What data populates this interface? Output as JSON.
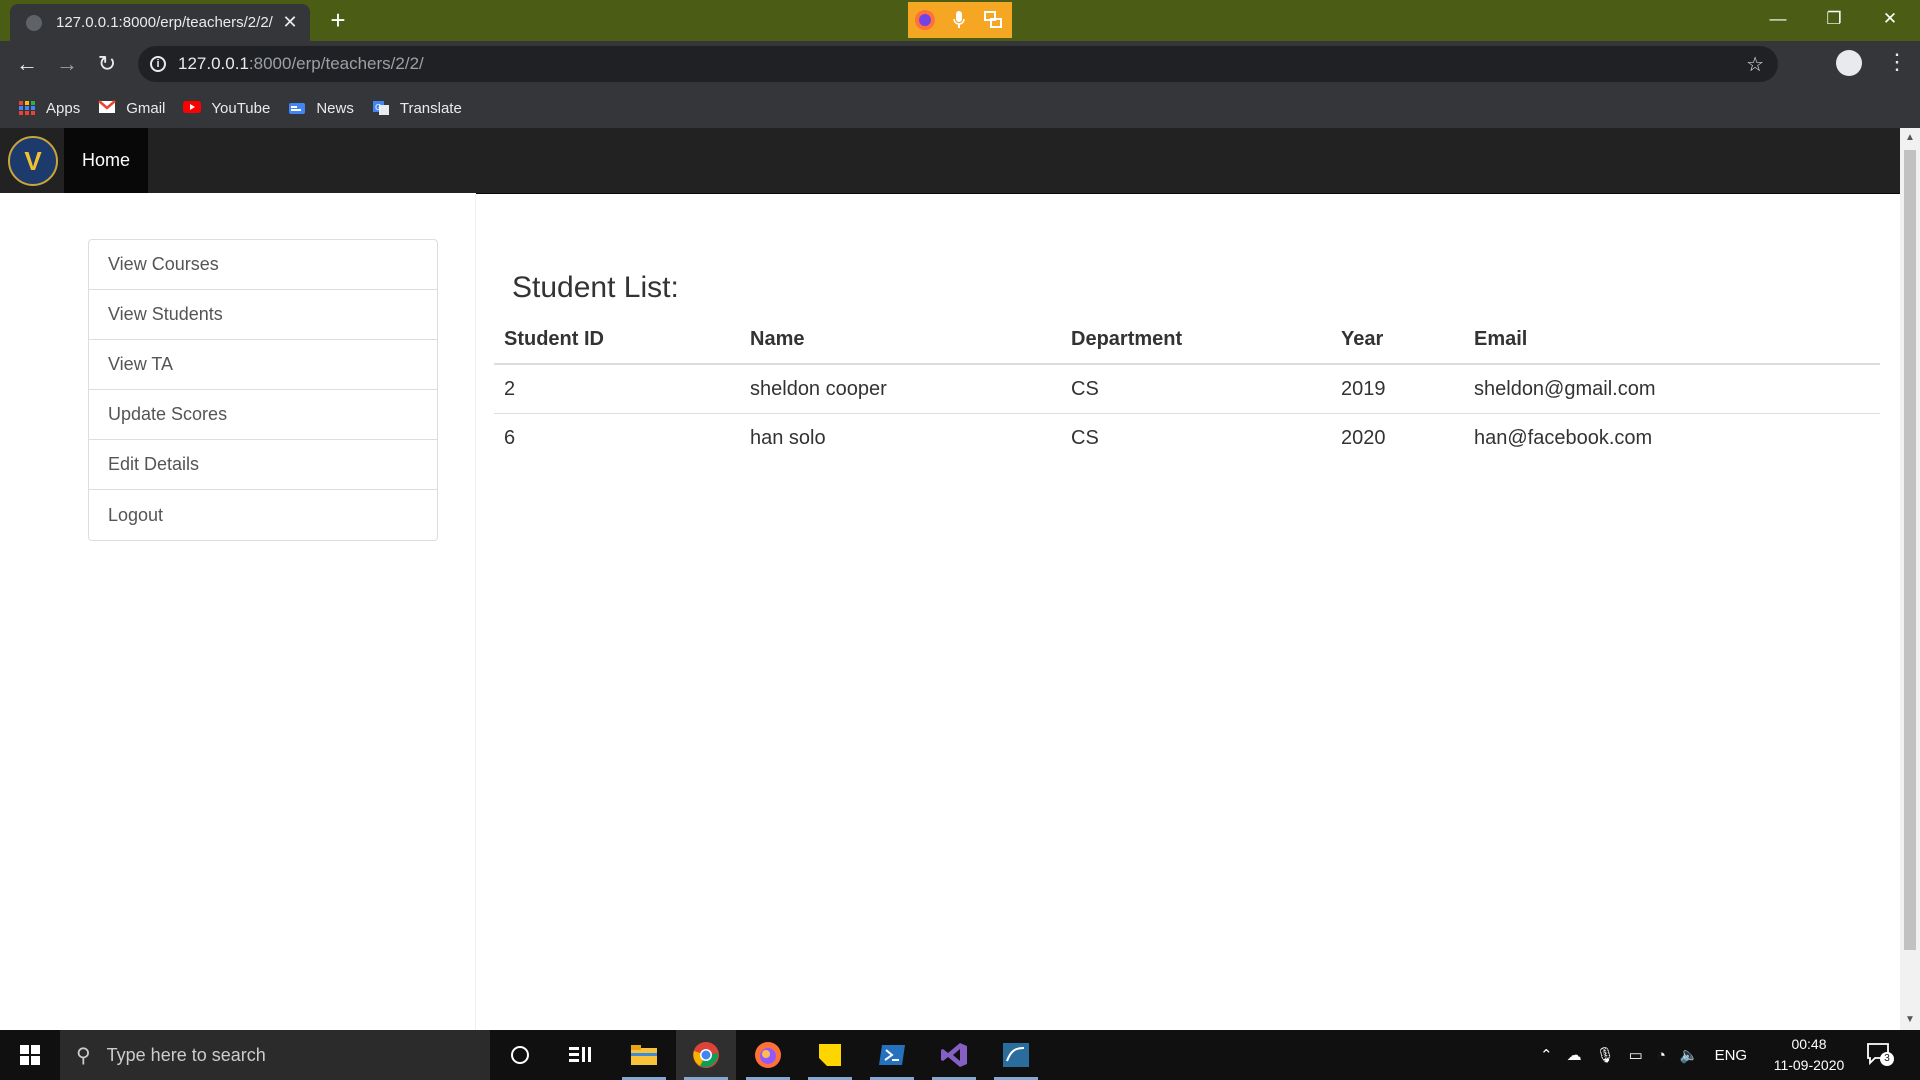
{
  "browser": {
    "tab_title": "127.0.0.1:8000/erp/teachers/2/2/",
    "url_host": "127.0.0.1",
    "url_rest": ":8000/erp/teachers/2/2/",
    "new_tab_label": "+",
    "bookmarks": [
      {
        "label": "Apps",
        "icon": "apps-grid-icon"
      },
      {
        "label": "Gmail",
        "icon": "gmail-icon"
      },
      {
        "label": "YouTube",
        "icon": "youtube-icon"
      },
      {
        "label": "News",
        "icon": "news-icon"
      },
      {
        "label": "Translate",
        "icon": "translate-icon"
      }
    ]
  },
  "navbar": {
    "home_label": "Home",
    "logo_letter": "V"
  },
  "sidebar": {
    "items": [
      {
        "label": "View Courses"
      },
      {
        "label": "View Students"
      },
      {
        "label": "View TA"
      },
      {
        "label": "Update Scores"
      },
      {
        "label": "Edit Details"
      },
      {
        "label": "Logout"
      }
    ]
  },
  "main": {
    "heading": "Student List:",
    "columns": [
      "Student ID",
      "Name",
      "Department",
      "Year",
      "Email"
    ],
    "rows": [
      [
        "2",
        "sheldon cooper",
        "CS",
        "2019",
        "sheldon@gmail.com"
      ],
      [
        "6",
        "han solo",
        "CS",
        "2020",
        "han@facebook.com"
      ]
    ]
  },
  "taskbar": {
    "search_placeholder": "Type here to search",
    "language": "ENG",
    "time": "00:48",
    "date": "11-09-2020",
    "notification_count": "3"
  },
  "colors": {
    "titlebar": "#4b5d14",
    "chrome_dark": "#35363a",
    "navbar": "#222222",
    "taskbar": "#101010"
  }
}
